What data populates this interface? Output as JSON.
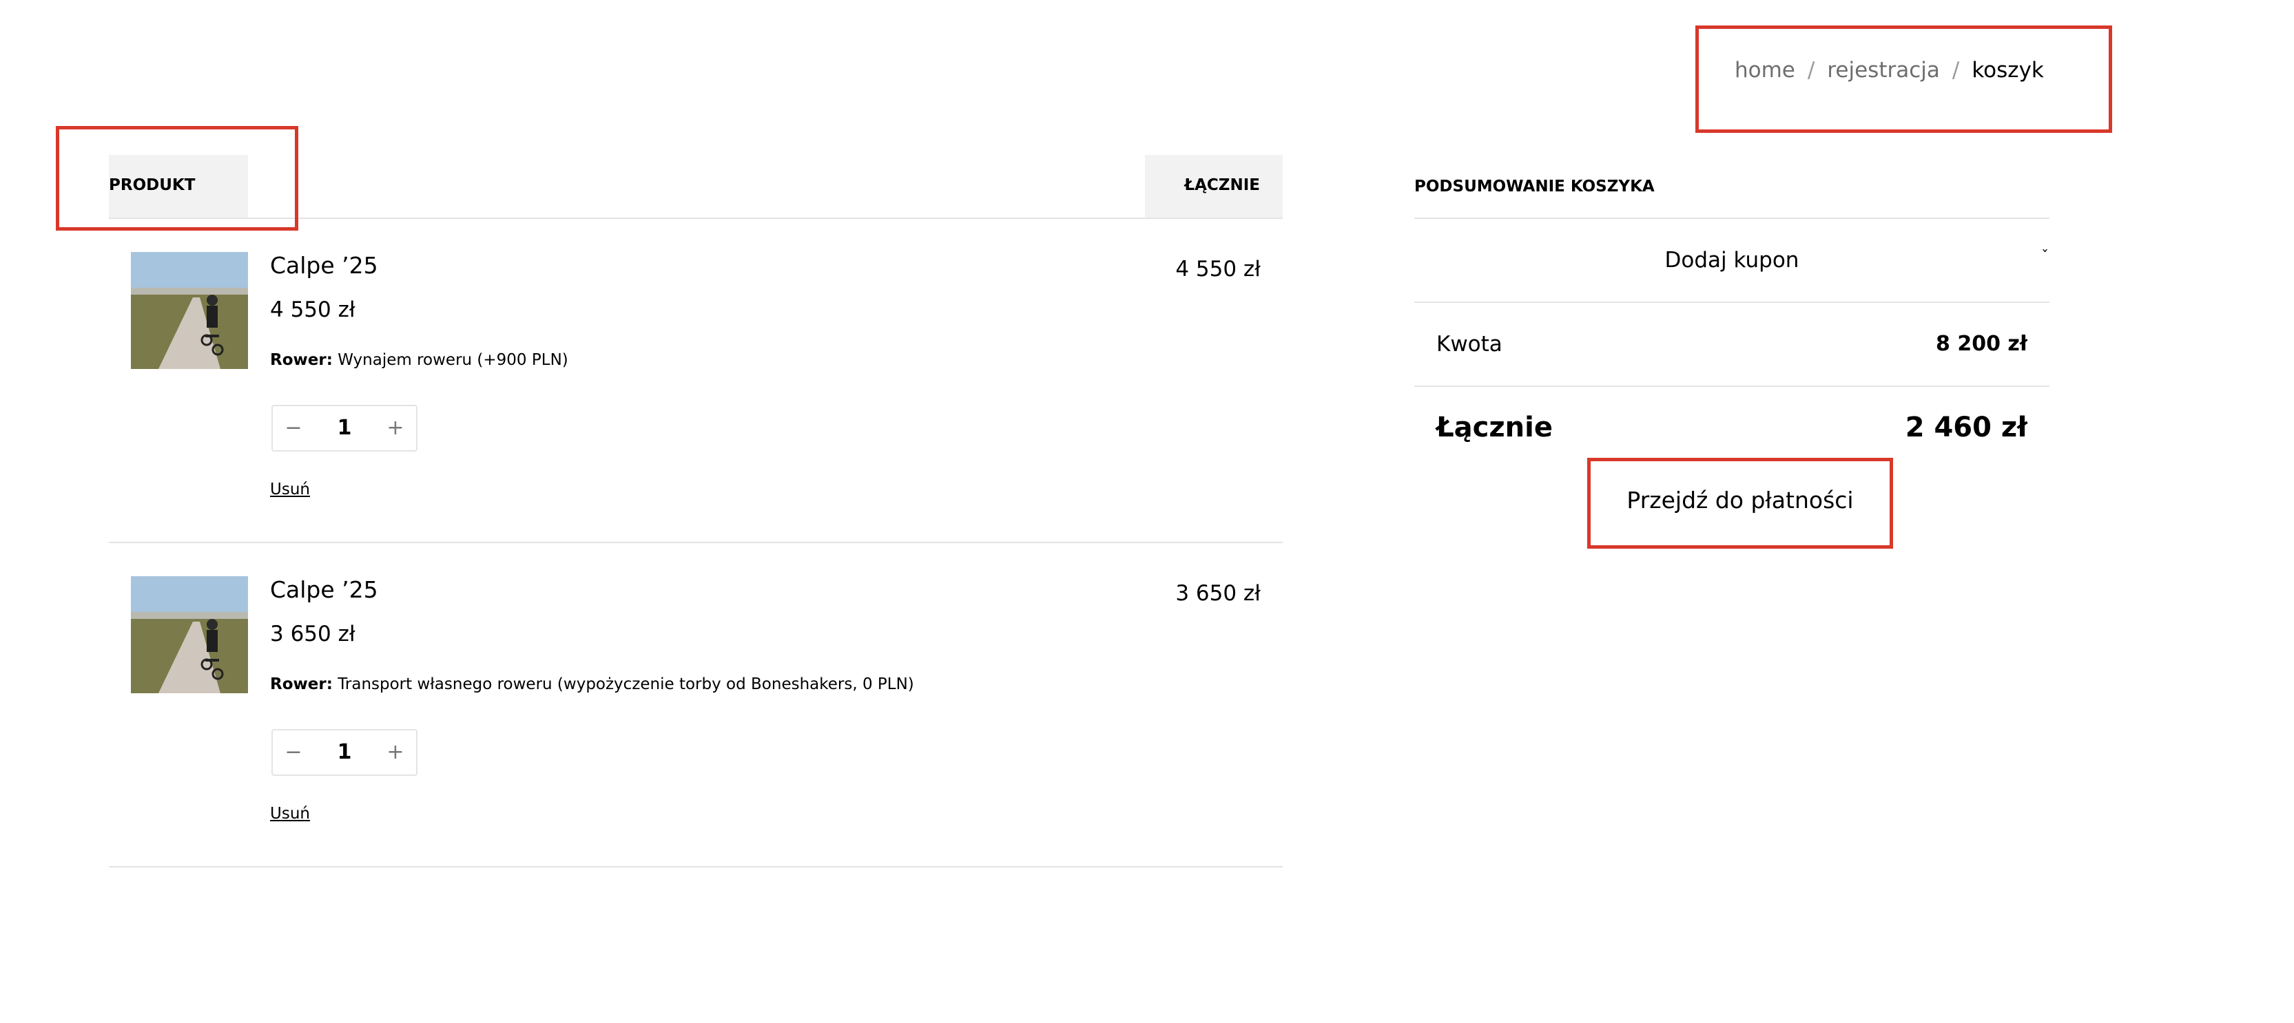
{
  "breadcrumb": {
    "items": [
      "home",
      "rejestracja",
      "koszyk"
    ],
    "separator": "/"
  },
  "cart_table": {
    "col_product": "PRODUKT",
    "col_total": "ŁĄCZNIE",
    "items": [
      {
        "name": "Calpe ’25",
        "price": "4 550 zł",
        "option_label": "Rower:",
        "option_value": "Wynajem roweru (+900 PLN)",
        "quantity": "1",
        "remove_label": "Usuń",
        "line_total": "4 550 zł",
        "qty_minus": "−",
        "qty_plus": "+"
      },
      {
        "name": "Calpe ’25",
        "price": "3 650 zł",
        "option_label": "Rower:",
        "option_value": "Transport własnego roweru (wypożyczenie torby od Boneshakers, 0 PLN)",
        "quantity": "1",
        "remove_label": "Usuń",
        "line_total": "3 650 zł",
        "qty_minus": "−",
        "qty_plus": "+"
      }
    ]
  },
  "summary": {
    "title": "PODSUMOWANIE KOSZYKA",
    "coupon_label": "Dodaj kupon",
    "coupon_chevron": "ˇ",
    "amount_label": "Kwota",
    "amount_value": "8 200 zł",
    "total_label": "Łącznie",
    "total_value": "2 460 zł",
    "checkout_label": "Przejdź do płatności"
  },
  "colors": {
    "annotation_red": "#d8382a",
    "header_bg": "#f2f2f2",
    "divider": "#e4e4e4",
    "muted_text": "#6e6e6e"
  }
}
